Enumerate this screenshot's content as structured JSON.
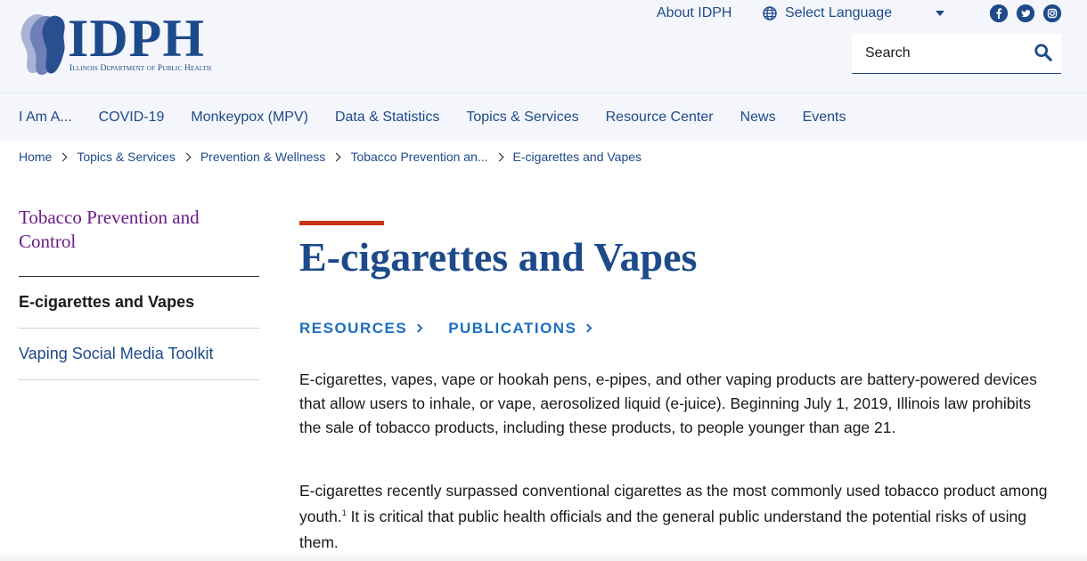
{
  "header": {
    "logo_text": "IDPH",
    "logo_subtitle": "Illinois Department of Public Health",
    "about_link": "About IDPH",
    "language_label": "Select Language",
    "search_placeholder": "Search"
  },
  "nav": {
    "items": [
      "I Am A...",
      "COVID-19",
      "Monkeypox (MPV)",
      "Data & Statistics",
      "Topics & Services",
      "Resource Center",
      "News",
      "Events"
    ]
  },
  "breadcrumb": {
    "items": [
      "Home",
      "Topics & Services",
      "Prevention & Wellness",
      "Tobacco Prevention an..."
    ],
    "current": "E-cigarettes and Vapes"
  },
  "sidebar": {
    "title": "Tobacco Prevention and Control",
    "items": [
      {
        "label": "E-cigarettes and Vapes",
        "active": true
      },
      {
        "label": "Vaping Social Media Toolkit",
        "active": false
      }
    ]
  },
  "content": {
    "title": "E-cigarettes and Vapes",
    "subnav": [
      "RESOURCES",
      "PUBLICATIONS"
    ],
    "paragraph1": "E-cigarettes, vapes, vape or hookah pens, e-pipes, and other vaping products are battery-powered devices that allow users to inhale, or vape, aerosolized liquid (e-juice). Beginning July 1, 2019, Illinois law prohibits the sale of tobacco products, including these products, to people younger than age 21.",
    "paragraph2_before": "E-cigarettes recently surpassed conventional cigarettes as the most commonly used tobacco product among youth.",
    "paragraph2_footnote": "1",
    "paragraph2_after": " It is critical that public health officials and the general public understand the potential risks of using them."
  },
  "colors": {
    "brand_blue": "#1d4a8a",
    "link_blue": "#1a6fc0",
    "accent_red": "#c8341c",
    "sidebar_title_purple": "#6a1b8a",
    "header_bg": "#f4f6fb"
  },
  "icons": [
    "globe-icon",
    "caret-down-icon",
    "facebook-icon",
    "twitter-icon",
    "instagram-icon",
    "search-icon",
    "chevron-right-icon"
  ]
}
